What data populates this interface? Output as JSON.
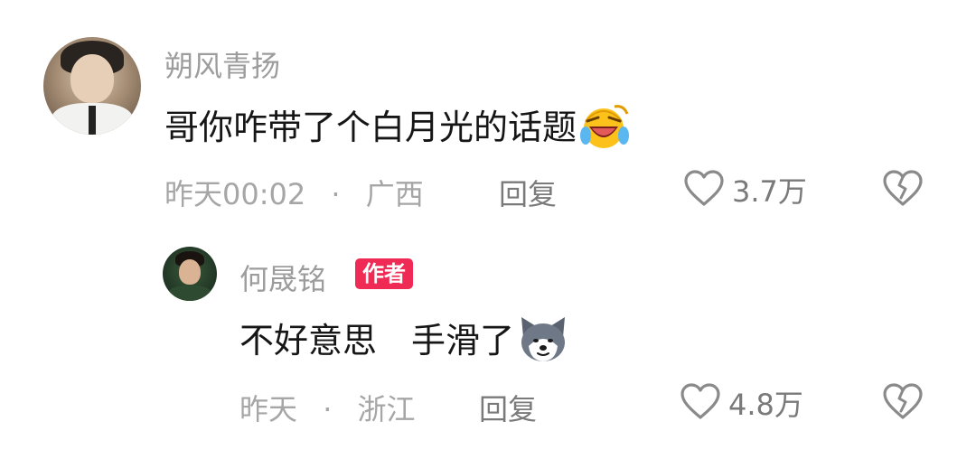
{
  "comments": [
    {
      "username": "朔风青扬",
      "text": "哥你咋带了个白月光的话题",
      "emoji": "laughing-crying-emoji",
      "time": "昨天00:02",
      "separator": "·",
      "location": "广西",
      "reply_label": "回复",
      "like_count": "3.7万"
    },
    {
      "username": "何晟铭",
      "badge": "作者",
      "text": "不好意思　手滑了",
      "emoji": "husky-dog-emoji",
      "time": "昨天",
      "separator": "·",
      "location": "浙江",
      "reply_label": "回复",
      "like_count": "4.8万"
    }
  ],
  "colors": {
    "author_badge": "#ee2a55",
    "muted_text": "#a6a6a6",
    "body_text": "#161616"
  }
}
